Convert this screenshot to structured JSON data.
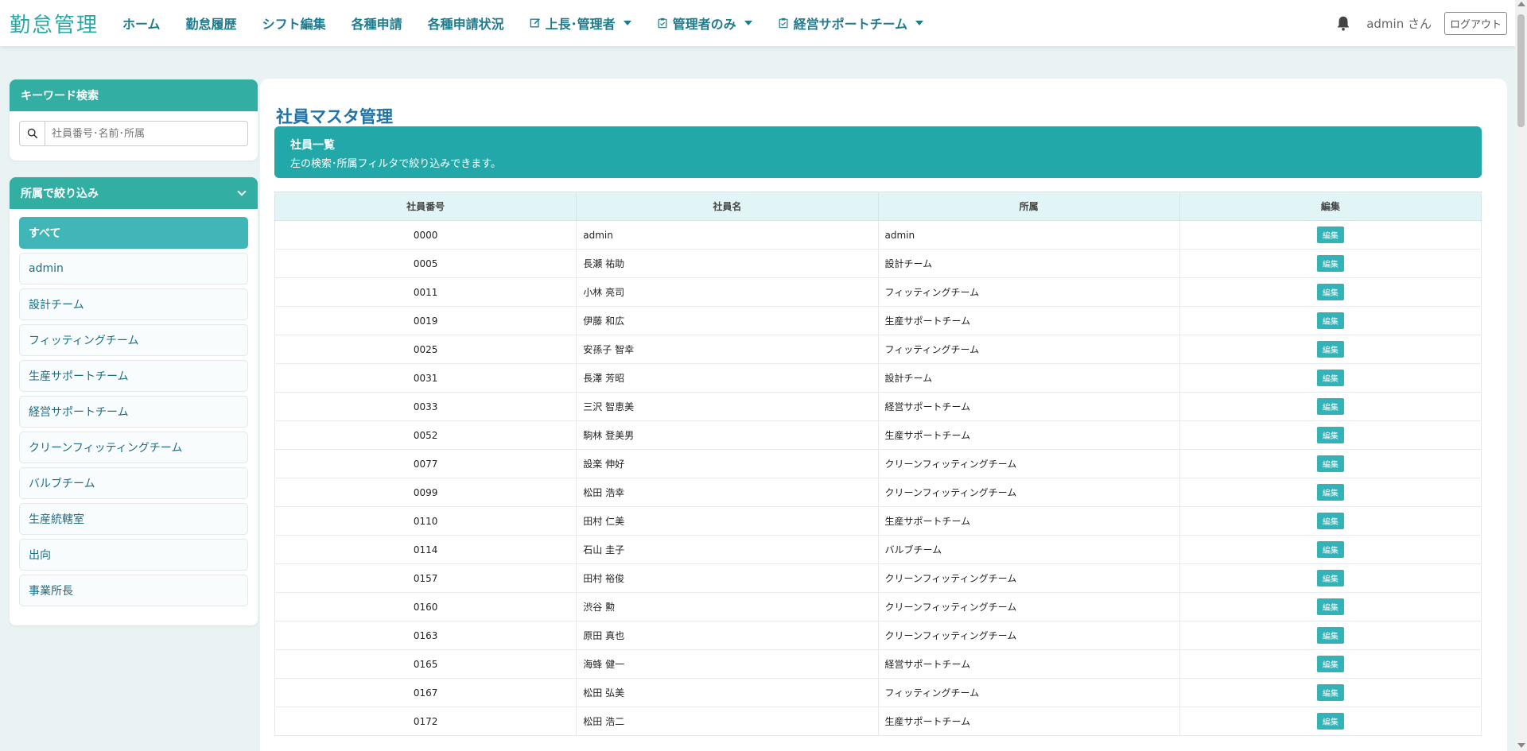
{
  "app": {
    "brand": "勤怠管理"
  },
  "nav": [
    {
      "label": "ホーム"
    },
    {
      "label": "勤怠履歴"
    },
    {
      "label": "シフト編集"
    },
    {
      "label": "各種申請"
    },
    {
      "label": "各種申請状況"
    },
    {
      "label": "上長･管理者",
      "icon": "edit-icon",
      "dropdown": true
    },
    {
      "label": "管理者のみ",
      "icon": "clipboard-icon",
      "dropdown": true
    },
    {
      "label": "経営サポートチーム",
      "icon": "clipboard-icon",
      "dropdown": true
    }
  ],
  "header": {
    "user": "admin さん",
    "logout": "ログアウト"
  },
  "sidebar": {
    "search_title": "キーワード検索",
    "search_placeholder": "社員番号･名前･所属",
    "filter_title": "所属で絞り込み",
    "departments": [
      "すべて",
      "admin",
      "設計チーム",
      "フィッティングチーム",
      "生産サポートチーム",
      "経営サポートチーム",
      "クリーンフィッティングチーム",
      "バルブチーム",
      "生産統轄室",
      "出向",
      "事業所長"
    ],
    "active_department": "すべて"
  },
  "main": {
    "title": "社員マスタ管理",
    "banner_title": "社員一覧",
    "banner_sub": "左の検索･所属フィルタで絞り込みできます。",
    "columns": [
      "社員番号",
      "社員名",
      "所属",
      "編集"
    ],
    "edit_label": "編集",
    "rows": [
      [
        "0000",
        "admin",
        "admin"
      ],
      [
        "0005",
        "長瀬 祐助",
        "設計チーム"
      ],
      [
        "0011",
        "小林 亮司",
        "フィッティングチーム"
      ],
      [
        "0019",
        "伊藤 和広",
        "生産サポートチーム"
      ],
      [
        "0025",
        "安孫子 智幸",
        "フィッティングチーム"
      ],
      [
        "0031",
        "長澤 芳昭",
        "設計チーム"
      ],
      [
        "0033",
        "三沢 智恵美",
        "経営サポートチーム"
      ],
      [
        "0052",
        "駒林 登美男",
        "生産サポートチーム"
      ],
      [
        "0077",
        "設楽 伸好",
        "クリーンフィッティングチーム"
      ],
      [
        "0099",
        "松田 浩幸",
        "クリーンフィッティングチーム"
      ],
      [
        "0110",
        "田村 仁美",
        "生産サポートチーム"
      ],
      [
        "0114",
        "石山 圭子",
        "バルブチーム"
      ],
      [
        "0157",
        "田村 裕俊",
        "クリーンフィッティングチーム"
      ],
      [
        "0160",
        "渋谷 勲",
        "クリーンフィッティングチーム"
      ],
      [
        "0163",
        "原田 真也",
        "クリーンフィッティングチーム"
      ],
      [
        "0165",
        "海蜂 健一",
        "経営サポートチーム"
      ],
      [
        "0167",
        "松田 弘美",
        "フィッティングチーム"
      ],
      [
        "0172",
        "松田 浩二",
        "生産サポートチーム"
      ]
    ]
  },
  "colors": {
    "accent": "#22a8a8",
    "brand": "#2aa8a6",
    "nav": "#1f7b8c"
  }
}
